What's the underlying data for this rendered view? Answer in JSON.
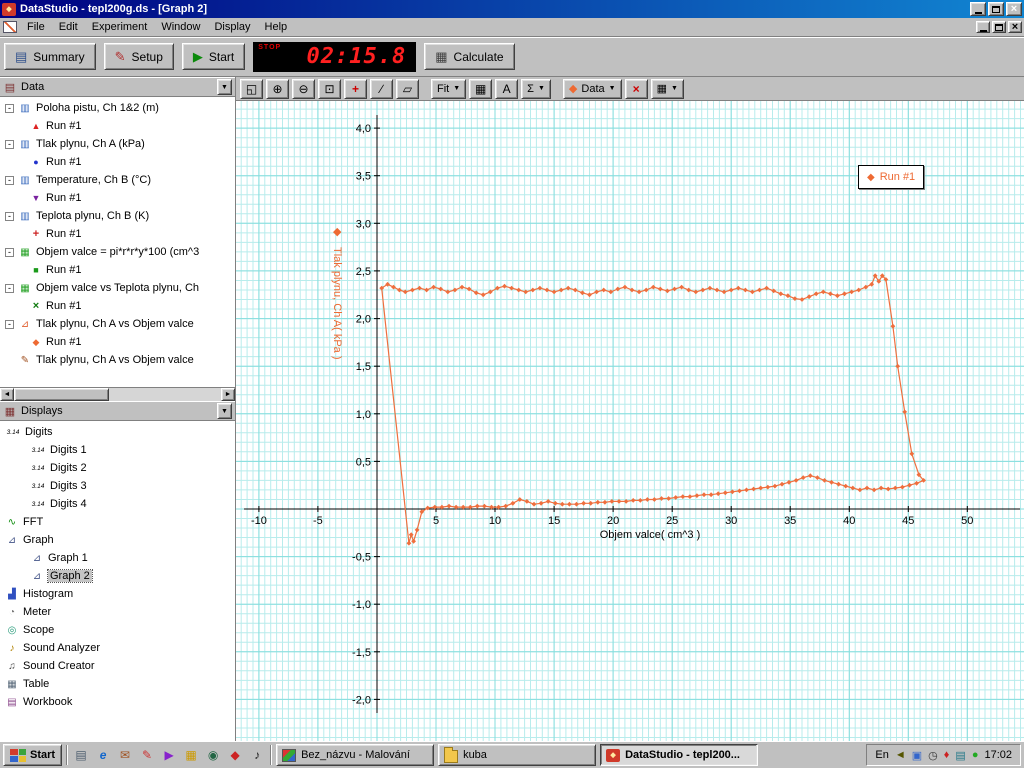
{
  "window": {
    "title": "DataStudio - tepl200g.ds - [Graph 2]",
    "menu": [
      "File",
      "Edit",
      "Experiment",
      "Window",
      "Display",
      "Help"
    ]
  },
  "toolbar": {
    "summary_label": "Summary",
    "setup_label": "Setup",
    "start_label": "Start",
    "timer_stop_label": "STOP",
    "timer_value": "02:15.8",
    "calculate_label": "Calculate"
  },
  "graph_toolbar": {
    "buttons": [
      {
        "name": "scale-to-fit",
        "glyph": "◱"
      },
      {
        "name": "zoom-in",
        "glyph": "⊕"
      },
      {
        "name": "zoom-out",
        "glyph": "⊖"
      },
      {
        "name": "zoom-select",
        "glyph": "⊡"
      },
      {
        "name": "smart-tool",
        "glyph": "+"
      },
      {
        "name": "slope-tool",
        "glyph": "∕"
      },
      {
        "name": "note-tool",
        "glyph": "▱"
      }
    ],
    "fit_label": "Fit",
    "calculator_glyph": "▦",
    "text_label": "A",
    "sigma_label": "Σ",
    "data_glyph": "◆",
    "data_label": "Data",
    "delete_glyph": "×",
    "settings_glyph": "▦"
  },
  "data_panel": {
    "title": "Data",
    "items": [
      {
        "label": "Poloha pistu, Ch 1&2 (m)",
        "icon": "▥",
        "marker": "▲",
        "run": "Run #1"
      },
      {
        "label": "Tlak plynu, Ch A (kPa)",
        "icon": "▥",
        "marker": "●",
        "run": "Run #1"
      },
      {
        "label": "Temperature, Ch B (°C)",
        "icon": "▥",
        "marker": "▼",
        "run": "Run #1"
      },
      {
        "label": "Teplota plynu, Ch B (K)",
        "icon": "▥",
        "marker": "+",
        "run": "Run #1"
      },
      {
        "label": "Objem valce = pi*r*r*y*100 (cm^3",
        "icon": "▦",
        "marker": "■",
        "run": "Run #1"
      },
      {
        "label": "Objem valce vs Teplota plynu, Ch",
        "icon": "▦",
        "marker": "×",
        "run": "Run #1"
      },
      {
        "label": "Tlak plynu, Ch A vs Objem valce",
        "icon": "⊿",
        "marker": "◆",
        "run": "Run #1"
      },
      {
        "label": "Tlak plynu, Ch A vs Objem valce",
        "icon": "✎"
      }
    ]
  },
  "displays_panel": {
    "title": "Displays",
    "rows": [
      {
        "label": "Digits",
        "glyph": "3.14",
        "level": 0
      },
      {
        "label": "Digits 1",
        "glyph": "3.14",
        "level": 1
      },
      {
        "label": "Digits 2",
        "glyph": "3.14",
        "level": 1
      },
      {
        "label": "Digits 3",
        "glyph": "3.14",
        "level": 1
      },
      {
        "label": "Digits 4",
        "glyph": "3.14",
        "level": 1
      },
      {
        "label": "FFT",
        "glyph": "∿",
        "level": 0
      },
      {
        "label": "Graph",
        "glyph": "⊿",
        "level": 0
      },
      {
        "label": "Graph 1",
        "glyph": "⊿",
        "level": 1
      },
      {
        "label": "Graph 2",
        "glyph": "⊿",
        "level": 1,
        "selected": true
      },
      {
        "label": "Histogram",
        "glyph": "▟",
        "level": 0
      },
      {
        "label": "Meter",
        "glyph": "◔",
        "level": 0
      },
      {
        "label": "Scope",
        "glyph": "◎",
        "level": 0
      },
      {
        "label": "Sound Analyzer",
        "glyph": "♪",
        "level": 0
      },
      {
        "label": "Sound Creator",
        "glyph": "♫",
        "level": 0
      },
      {
        "label": "Table",
        "glyph": "▦",
        "level": 0
      },
      {
        "label": "Workbook",
        "glyph": "▤",
        "level": 0
      }
    ]
  },
  "chart_data": {
    "type": "scatter",
    "xlabel": "Objem valce( cm^3 )",
    "ylabel": "Tlak plynu, Ch A( kPa )",
    "xlim": [
      -11.94,
      54.8
    ],
    "ylim": [
      -2.437,
      4.285
    ],
    "x_minor": 0.5,
    "x_major": 5,
    "y_minor": 0.1,
    "y_major": 0.5,
    "x_ticks": [
      -10,
      -5,
      5,
      10,
      15,
      20,
      25,
      30,
      35,
      40,
      45,
      50
    ],
    "y_ticks": [
      [
        4,
        "4,0"
      ],
      [
        3.5,
        "3,5"
      ],
      [
        3,
        "3,0"
      ],
      [
        2.5,
        "2,5"
      ],
      [
        2,
        "2,0"
      ],
      [
        1.5,
        "1,5"
      ],
      [
        1,
        "1,0"
      ],
      [
        0.5,
        "0,5"
      ],
      [
        -0.5,
        "-0,5"
      ],
      [
        -1,
        "-1,0"
      ],
      [
        -1.5,
        "-1,5"
      ],
      [
        -2,
        "-2,0"
      ]
    ],
    "grid_minor_color": "#b8ecec",
    "grid_major_color": "#86dede",
    "axis_color": "#000000",
    "legend": {
      "label": "Run #1",
      "position": "top-right"
    },
    "series": [
      {
        "name": "Run #1",
        "color": "#ef6f3e",
        "marker": "diamond",
        "closed": true,
        "points": [
          [
            0.4,
            2.32
          ],
          [
            0.9,
            2.36
          ],
          [
            1.4,
            2.33
          ],
          [
            1.9,
            2.3
          ],
          [
            2.4,
            2.28
          ],
          [
            3,
            2.3
          ],
          [
            3.6,
            2.32
          ],
          [
            4.2,
            2.3
          ],
          [
            4.8,
            2.33
          ],
          [
            5.4,
            2.31
          ],
          [
            6,
            2.28
          ],
          [
            6.6,
            2.3
          ],
          [
            7.2,
            2.33
          ],
          [
            7.8,
            2.31
          ],
          [
            8.4,
            2.27
          ],
          [
            9,
            2.25
          ],
          [
            9.6,
            2.28
          ],
          [
            10.2,
            2.32
          ],
          [
            10.8,
            2.34
          ],
          [
            11.4,
            2.32
          ],
          [
            12,
            2.3
          ],
          [
            12.6,
            2.28
          ],
          [
            13.2,
            2.3
          ],
          [
            13.8,
            2.32
          ],
          [
            14.4,
            2.3
          ],
          [
            15,
            2.28
          ],
          [
            15.6,
            2.3
          ],
          [
            16.2,
            2.32
          ],
          [
            16.8,
            2.3
          ],
          [
            17.4,
            2.27
          ],
          [
            18,
            2.25
          ],
          [
            18.6,
            2.28
          ],
          [
            19.2,
            2.3
          ],
          [
            19.8,
            2.28
          ],
          [
            20.4,
            2.31
          ],
          [
            21,
            2.33
          ],
          [
            21.6,
            2.3
          ],
          [
            22.2,
            2.28
          ],
          [
            22.8,
            2.3
          ],
          [
            23.4,
            2.33
          ],
          [
            24,
            2.31
          ],
          [
            24.6,
            2.29
          ],
          [
            25.2,
            2.31
          ],
          [
            25.8,
            2.33
          ],
          [
            26.4,
            2.3
          ],
          [
            27,
            2.28
          ],
          [
            27.6,
            2.3
          ],
          [
            28.2,
            2.32
          ],
          [
            28.8,
            2.3
          ],
          [
            29.4,
            2.28
          ],
          [
            30,
            2.3
          ],
          [
            30.6,
            2.32
          ],
          [
            31.2,
            2.3
          ],
          [
            31.8,
            2.28
          ],
          [
            32.4,
            2.3
          ],
          [
            33,
            2.32
          ],
          [
            33.6,
            2.29
          ],
          [
            34.2,
            2.26
          ],
          [
            34.8,
            2.24
          ],
          [
            35.4,
            2.21
          ],
          [
            36,
            2.2
          ],
          [
            36.6,
            2.23
          ],
          [
            37.2,
            2.26
          ],
          [
            37.8,
            2.28
          ],
          [
            38.4,
            2.26
          ],
          [
            39,
            2.24
          ],
          [
            39.6,
            2.26
          ],
          [
            40.2,
            2.28
          ],
          [
            40.8,
            2.3
          ],
          [
            41.4,
            2.33
          ],
          [
            41.9,
            2.36
          ],
          [
            42.2,
            2.45
          ],
          [
            42.5,
            2.39
          ],
          [
            42.8,
            2.45
          ],
          [
            43.1,
            2.41
          ],
          [
            43.7,
            1.92
          ],
          [
            44.1,
            1.5
          ],
          [
            44.7,
            1.02
          ],
          [
            45.3,
            0.58
          ],
          [
            45.9,
            0.36
          ],
          [
            46.3,
            0.3
          ],
          [
            45.7,
            0.27
          ],
          [
            45.1,
            0.25
          ],
          [
            44.5,
            0.23
          ],
          [
            43.9,
            0.22
          ],
          [
            43.3,
            0.21
          ],
          [
            42.7,
            0.22
          ],
          [
            42.1,
            0.2
          ],
          [
            41.5,
            0.22
          ],
          [
            40.9,
            0.2
          ],
          [
            40.3,
            0.22
          ],
          [
            39.7,
            0.24
          ],
          [
            39.1,
            0.26
          ],
          [
            38.5,
            0.28
          ],
          [
            37.9,
            0.3
          ],
          [
            37.3,
            0.33
          ],
          [
            36.7,
            0.35
          ],
          [
            36.1,
            0.33
          ],
          [
            35.5,
            0.3
          ],
          [
            34.9,
            0.28
          ],
          [
            34.3,
            0.26
          ],
          [
            33.7,
            0.24
          ],
          [
            33.1,
            0.23
          ],
          [
            32.5,
            0.22
          ],
          [
            31.9,
            0.21
          ],
          [
            31.3,
            0.2
          ],
          [
            30.7,
            0.19
          ],
          [
            30.1,
            0.18
          ],
          [
            29.5,
            0.17
          ],
          [
            28.9,
            0.16
          ],
          [
            28.3,
            0.15
          ],
          [
            27.7,
            0.15
          ],
          [
            27.1,
            0.14
          ],
          [
            26.5,
            0.13
          ],
          [
            25.9,
            0.13
          ],
          [
            25.3,
            0.12
          ],
          [
            24.7,
            0.11
          ],
          [
            24.1,
            0.11
          ],
          [
            23.5,
            0.1
          ],
          [
            22.9,
            0.1
          ],
          [
            22.3,
            0.09
          ],
          [
            21.7,
            0.09
          ],
          [
            21.1,
            0.08
          ],
          [
            20.5,
            0.08
          ],
          [
            19.9,
            0.08
          ],
          [
            19.3,
            0.07
          ],
          [
            18.7,
            0.07
          ],
          [
            18.1,
            0.06
          ],
          [
            17.5,
            0.06
          ],
          [
            16.9,
            0.05
          ],
          [
            16.3,
            0.05
          ],
          [
            15.7,
            0.05
          ],
          [
            15.1,
            0.06
          ],
          [
            14.5,
            0.08
          ],
          [
            13.9,
            0.06
          ],
          [
            13.3,
            0.05
          ],
          [
            12.7,
            0.08
          ],
          [
            12.1,
            0.1
          ],
          [
            11.5,
            0.06
          ],
          [
            10.9,
            0.03
          ],
          [
            10.3,
            0.02
          ],
          [
            9.7,
            0.02
          ],
          [
            9.1,
            0.03
          ],
          [
            8.5,
            0.03
          ],
          [
            7.9,
            0.02
          ],
          [
            7.3,
            0.02
          ],
          [
            6.7,
            0.02
          ],
          [
            6.1,
            0.03
          ],
          [
            5.5,
            0.02
          ],
          [
            4.9,
            0.02
          ],
          [
            4.3,
            0.01
          ],
          [
            3.8,
            -0.03
          ],
          [
            3.4,
            -0.22
          ],
          [
            3.1,
            -0.34
          ],
          [
            2.9,
            -0.27
          ],
          [
            2.7,
            -0.36
          ]
        ]
      }
    ]
  },
  "taskbar": {
    "start_label": "Start",
    "quick_launch": [
      {
        "name": "show-desktop",
        "glyph": "▤"
      },
      {
        "name": "internet-explorer",
        "glyph": "e"
      },
      {
        "name": "mail",
        "glyph": "✉"
      },
      {
        "name": "paint",
        "glyph": "✎"
      },
      {
        "name": "media-player",
        "glyph": "▶"
      },
      {
        "name": "explorer",
        "glyph": "▦"
      },
      {
        "name": "browser",
        "glyph": "◉"
      },
      {
        "name": "reader",
        "glyph": "◆"
      },
      {
        "name": "music",
        "glyph": "♪"
      }
    ],
    "tasks": [
      {
        "label": "Bez_názvu - Malování"
      },
      {
        "label": "kuba"
      },
      {
        "label": "DataStudio - tepl200...",
        "active": true
      }
    ],
    "language_indicator": "En",
    "tray_icons": [
      {
        "name": "volume",
        "glyph": "◄"
      },
      {
        "name": "display",
        "glyph": "▣"
      },
      {
        "name": "scheduler",
        "glyph": "◷"
      },
      {
        "name": "antivirus",
        "glyph": "♦"
      },
      {
        "name": "network",
        "glyph": "▤"
      },
      {
        "name": "updater",
        "glyph": "●"
      }
    ],
    "clock": "17:02"
  }
}
